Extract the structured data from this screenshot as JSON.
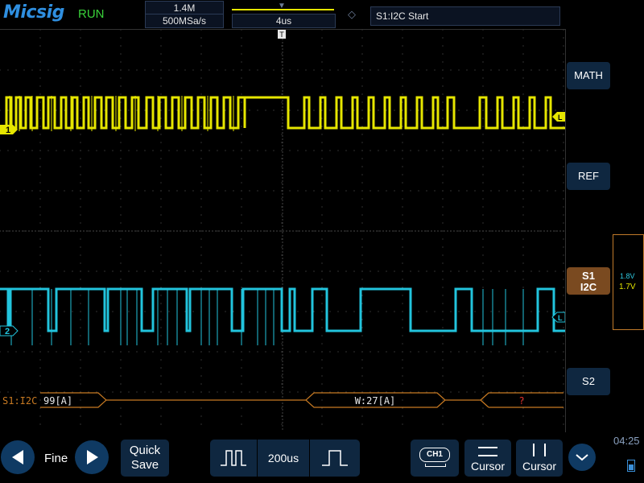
{
  "header": {
    "logo": "Micsig",
    "run_state": "RUN",
    "memory_depth": "1.4M",
    "sample_rate": "500MSa/s",
    "timebase": "4us",
    "trigger_status": "S1:I2C Start"
  },
  "channels": {
    "ch1_label": "1",
    "ch2_label": "2",
    "level_marker": "L",
    "trigger_marker": "T"
  },
  "decode": {
    "label": "S1:I2C",
    "packets": [
      "99[A]",
      "W:27[A]",
      "?"
    ]
  },
  "right_panel": {
    "math": "MATH",
    "ref": "REF",
    "s1_line1": "S1",
    "s1_line2": "I2C",
    "s2": "S2",
    "level_ch2": "1.8V",
    "level_ch1": "1.7V"
  },
  "bottom": {
    "fine_label": "Fine",
    "quick_save_line1": "Quick",
    "quick_save_line2": "Save",
    "pulse_time": "200us",
    "ch1_badge": "CH1",
    "cursor1": "Cursor",
    "cursor2": "Cursor",
    "clock": "04:25"
  },
  "colors": {
    "ch1": "#e6e600",
    "ch2": "#22c4dd",
    "decode": "#c87a22",
    "grid": "#5a5a5a"
  }
}
